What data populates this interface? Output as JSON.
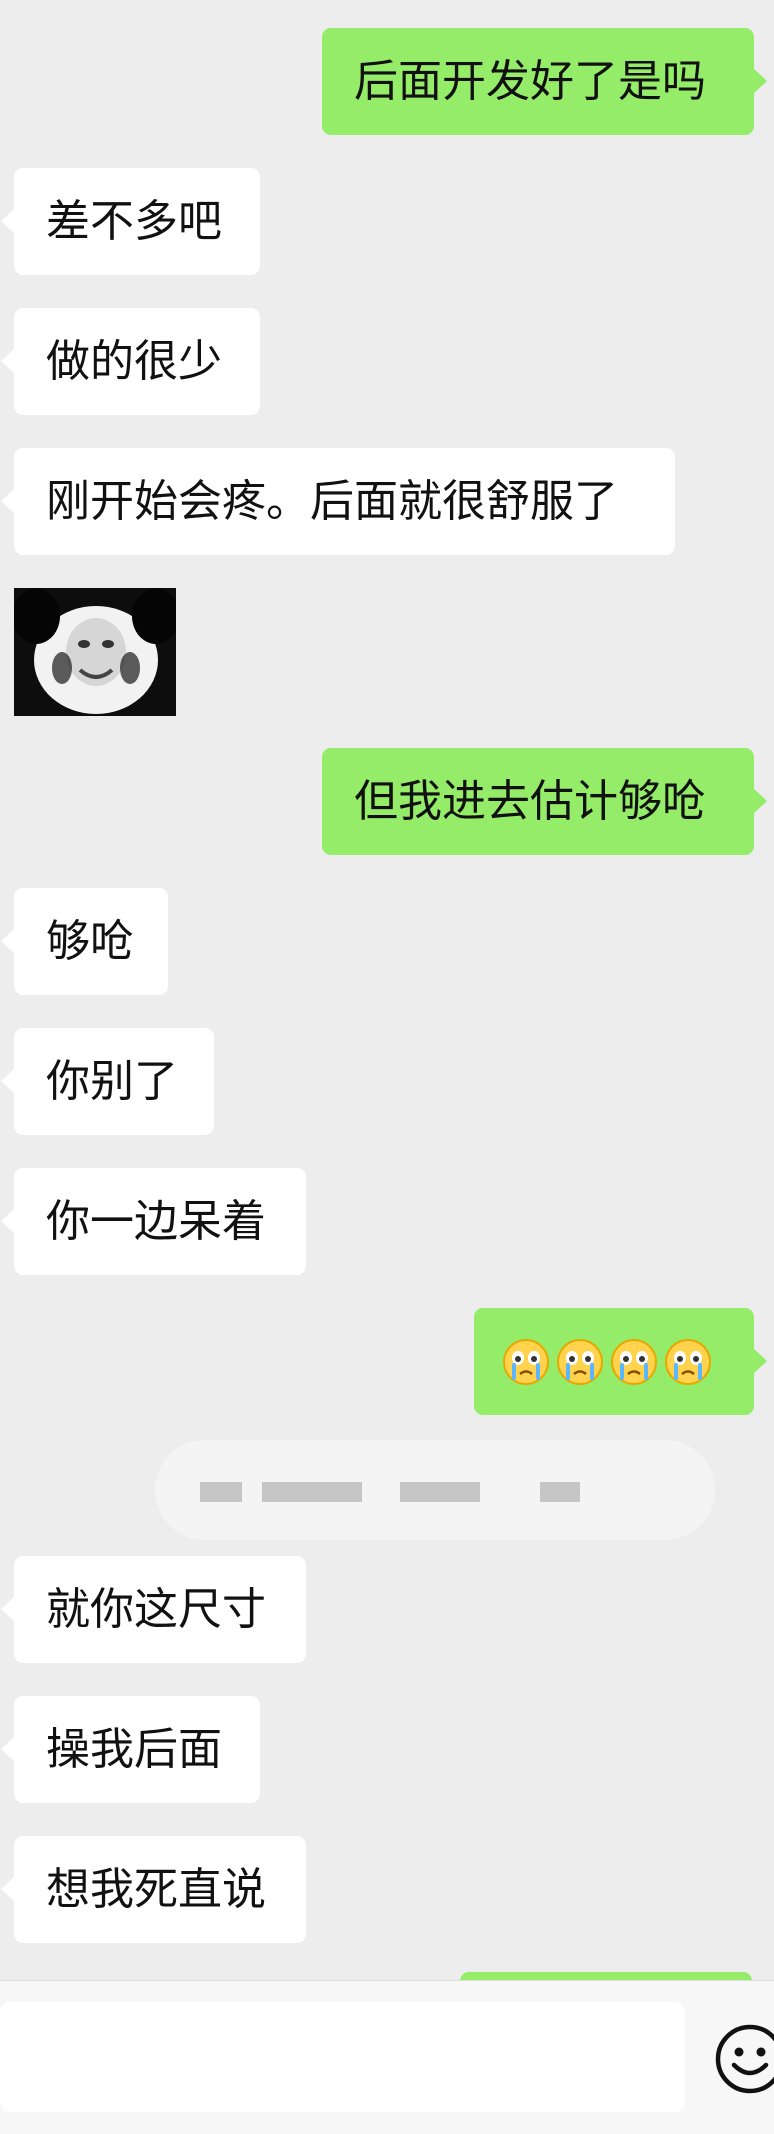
{
  "messages": [
    {
      "side": "right",
      "text": "后面开发好了是吗"
    },
    {
      "side": "left",
      "text": "差不多吧"
    },
    {
      "side": "left",
      "text": "做的很少"
    },
    {
      "side": "left",
      "text": "刚开始会疼。后面就很舒服了"
    },
    {
      "side": "left",
      "type": "sticker",
      "sticker_icon": "panda-meme-sticker"
    },
    {
      "side": "right",
      "text": "但我进去估计够呛"
    },
    {
      "side": "left",
      "text": "够呛"
    },
    {
      "side": "left",
      "text": "你别了"
    },
    {
      "side": "left",
      "text": "你一边呆着"
    },
    {
      "side": "right",
      "type": "emoji",
      "emoji_icon": "crying-face-emoji",
      "count": 4
    },
    {
      "side": "left",
      "text": "就你这尺寸"
    },
    {
      "side": "left",
      "text": "操我后面"
    },
    {
      "side": "left",
      "text": "想我死直说"
    }
  ],
  "colors": {
    "background": "#ededed",
    "incoming_bubble": "#ffffff",
    "outgoing_bubble": "#95ec69"
  },
  "input_bar": {
    "input_value": "",
    "emoji_button_icon": "smiley-face-icon"
  }
}
